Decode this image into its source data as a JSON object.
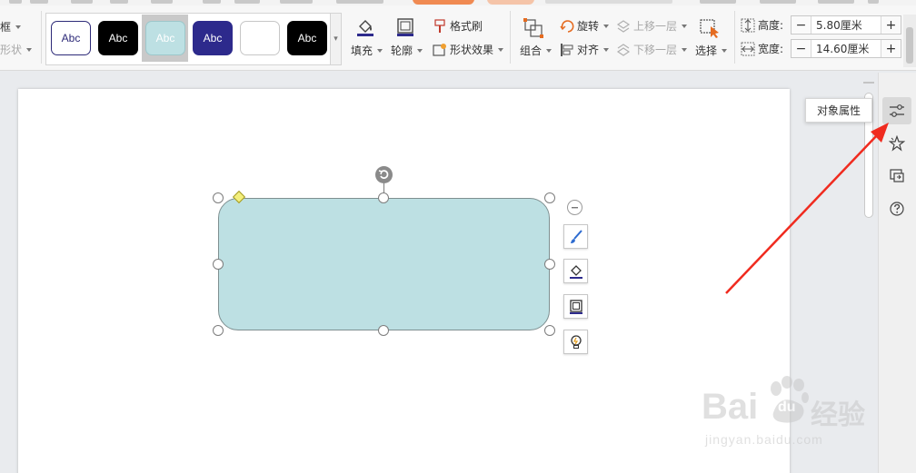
{
  "ribbon": {
    "left_cut": {
      "border_label": "框",
      "shape_label": "形状"
    },
    "style_gallery": [
      {
        "label": "Abc",
        "bg": "#ffffff",
        "fg": "#2d2a78",
        "border": "#2d2a78"
      },
      {
        "label": "Abc",
        "bg": "#000000",
        "fg": "#ffffff",
        "border": "#000000"
      },
      {
        "label": "Abc",
        "bg": "#bde0e3",
        "fg": "#ffffff",
        "border": "#9cc7cb",
        "selected": true
      },
      {
        "label": "Abc",
        "bg": "#2d2a8c",
        "fg": "#ffffff",
        "border": "#2d2a8c"
      },
      {
        "label": "",
        "bg": "#ffffff",
        "fg": "#333333",
        "border": "#c7c7c7"
      },
      {
        "label": "Abc",
        "bg": "#000000",
        "fg": "#ffffff",
        "border": "#000000"
      }
    ],
    "fill_label": "填充",
    "outline_label": "轮廓",
    "format_painter_label": "格式刷",
    "shape_effects_label": "形状效果",
    "group_label": "组合",
    "rotate_label": "旋转",
    "align_label": "对齐",
    "bring_forward_label": "上移一层",
    "send_backward_label": "下移一层",
    "select_label": "选择",
    "height_label": "高度:",
    "height_value": "5.80厘米",
    "width_label": "宽度:",
    "width_value": "14.60厘米",
    "minus": "−",
    "plus": "+"
  },
  "tooltip": {
    "text": "对象属性"
  },
  "side_panel": {
    "items": [
      {
        "icon": "object-properties-icon",
        "active": true
      },
      {
        "icon": "star-animation-icon",
        "active": false
      },
      {
        "icon": "slide-transition-icon",
        "active": false
      },
      {
        "icon": "help-icon",
        "active": false
      }
    ]
  },
  "shape": {
    "fill": "#bde0e3",
    "stroke": "#7e8f90"
  },
  "float_toolbar": [
    "style-brush-icon",
    "fill-bucket-icon",
    "outline-icon",
    "lightbulb-icon"
  ],
  "annotation": {
    "arrow_color": "#f02b1f"
  },
  "watermark": {
    "brand": "Bai",
    "brand_tail": "经验",
    "paw_text": "du",
    "url": "jingyan.baidu.com"
  }
}
